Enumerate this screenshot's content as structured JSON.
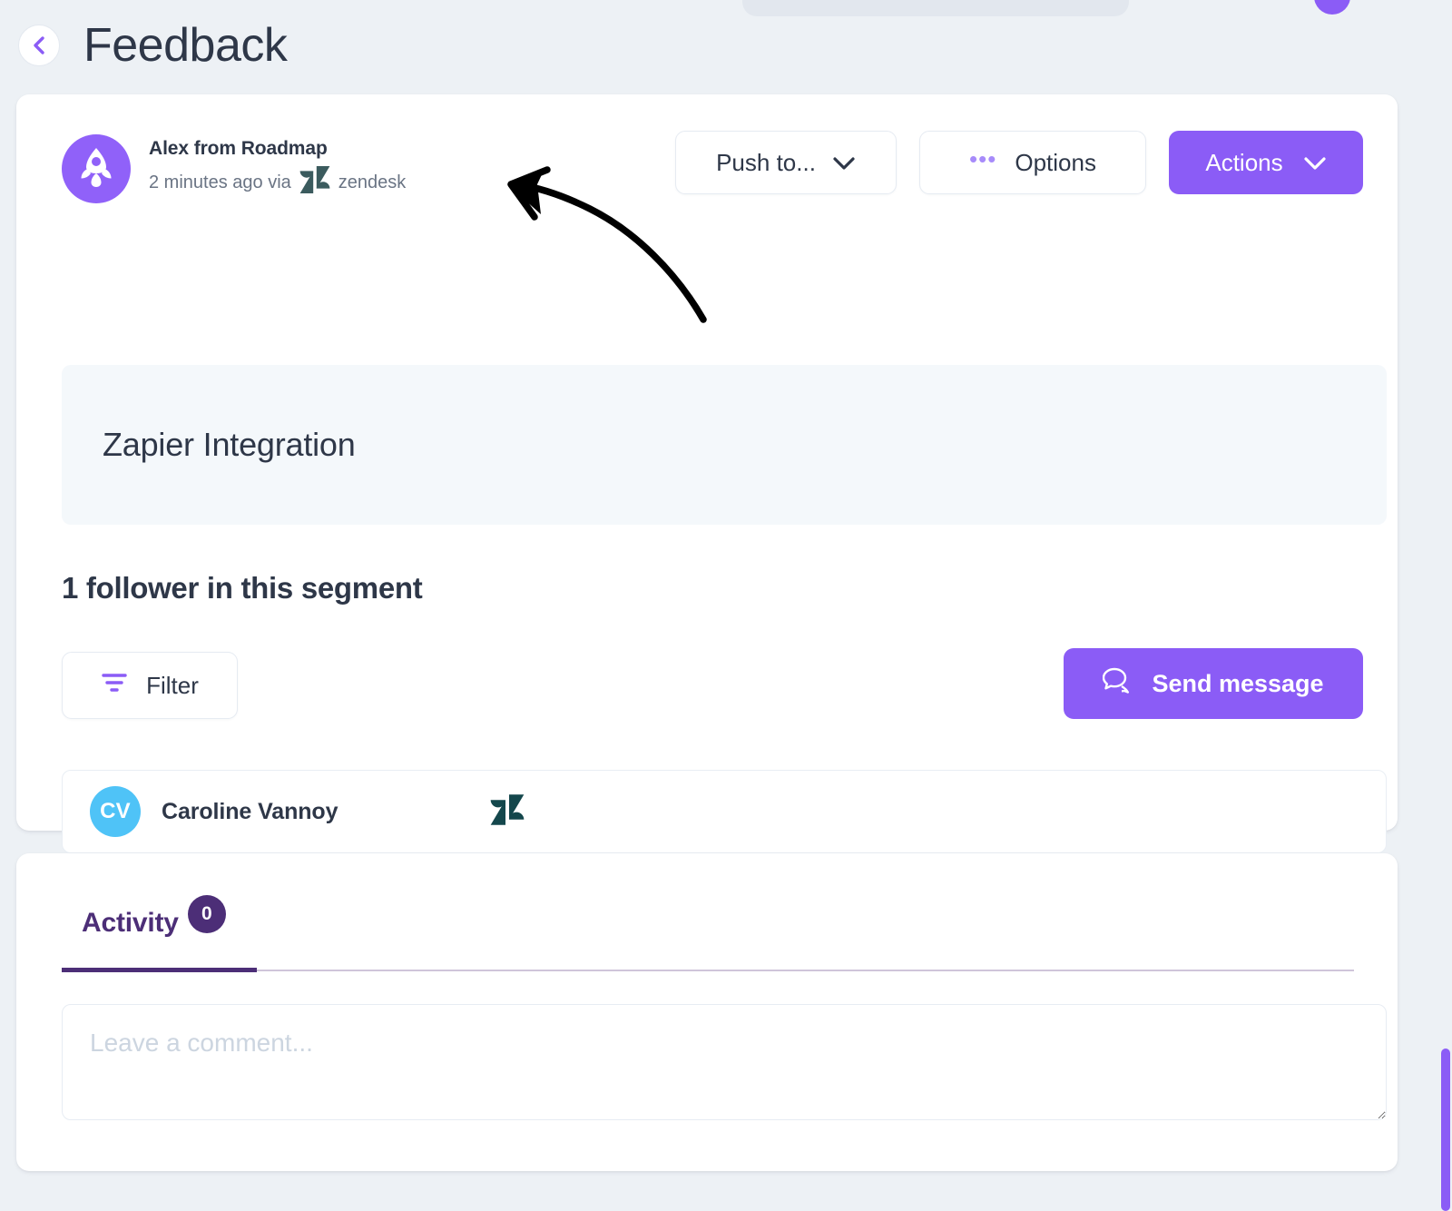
{
  "header": {
    "back_icon": "chevron-left-icon",
    "title": "Feedback"
  },
  "feedback": {
    "author": {
      "avatar_icon": "rocket-icon",
      "name": "Alex from Roadmap"
    },
    "timestamp_prefix": "2 minutes ago via",
    "source_icon": "zendesk-logo-icon",
    "source_label": "zendesk",
    "title": "Zapier Integration"
  },
  "toolbar": {
    "push_to_label": "Push to...",
    "push_to_icon": "chevron-down-icon",
    "options_icon": "ellipsis-icon",
    "options_label": "Options",
    "actions_label": "Actions",
    "actions_icon": "chevron-down-icon"
  },
  "followers": {
    "heading": "1 follower in this segment",
    "filter_label": "Filter",
    "filter_icon": "filter-icon",
    "send_message_label": "Send message",
    "send_message_icon": "chat-bubble-icon",
    "list": [
      {
        "initials": "CV",
        "name": "Caroline Vannoy",
        "source_icon": "zendesk-logo-icon"
      }
    ]
  },
  "activity": {
    "tabs": [
      {
        "label": "Activity",
        "badge": "0",
        "active": true
      }
    ],
    "comment_placeholder": "Leave a comment...",
    "comment_value": ""
  },
  "colors": {
    "accent_purple": "#8b5cf6",
    "avatar_purple": "#9061f9",
    "tab_purple": "#4c2e77",
    "follower_avatar_blue": "#4fc3f7",
    "zendesk_teal": "#17494d",
    "page_background": "#edf1f5",
    "panel_background": "#f4f8fb",
    "text_primary": "#2e3748",
    "text_muted": "#6a7484"
  },
  "annotation": {
    "shape": "curved-arrow",
    "points_to": "zendesk source label"
  },
  "scrollbar": {
    "orientation": "vertical",
    "position": "right"
  }
}
